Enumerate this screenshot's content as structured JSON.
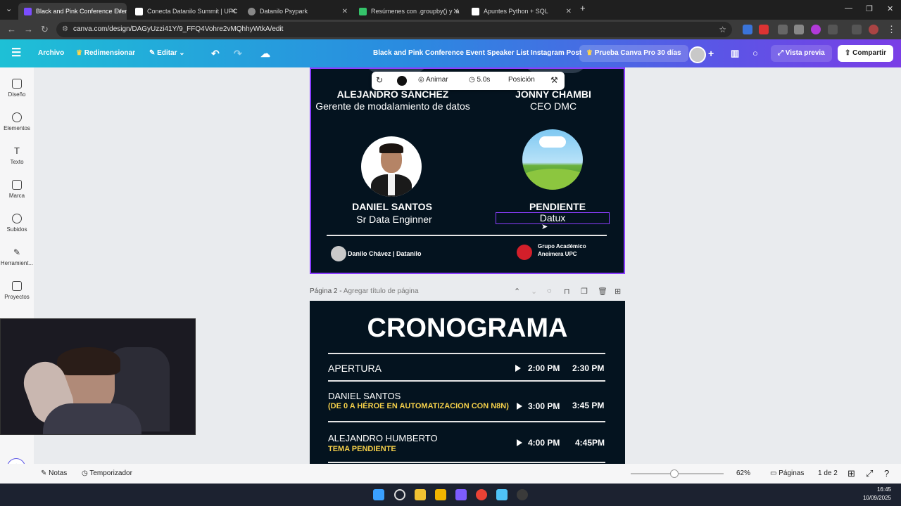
{
  "browser": {
    "tabs": [
      {
        "title": "Black and Pink Conference Even",
        "active": true
      },
      {
        "title": "Conecta Datanilo Summit | UPC",
        "active": false
      },
      {
        "title": "Datanilo Psypark",
        "active": false
      },
      {
        "title": "Resúmenes con .groupby() y .a",
        "active": false
      },
      {
        "title": "Apuntes Python + SQL",
        "active": false
      }
    ],
    "new_tab": "+",
    "url": "canva.com/design/DAGyUzzi41Y/9_FFQ4Vohre2vMQhhyWtkA/edit"
  },
  "header": {
    "menu_file": "Archivo",
    "resize": "Redimensionar",
    "edit": "Editar",
    "doc_title": "Black and Pink Conference Event Speaker List Instagram Post",
    "try_pro": "Prueba Canva Pro 30 días",
    "preview": "Vista previa",
    "share": "Compartir"
  },
  "sidebar": {
    "items": [
      {
        "label": "Diseño"
      },
      {
        "label": "Elementos"
      },
      {
        "label": "Texto"
      },
      {
        "label": "Marca"
      },
      {
        "label": "Subidos"
      },
      {
        "label": "Herramient..."
      },
      {
        "label": "Proyectos"
      }
    ]
  },
  "element_toolbar": {
    "animate": "Animar",
    "duration": "5.0s",
    "position": "Posición"
  },
  "page1": {
    "speakers": [
      {
        "name": "ALEJANDRO SÁNCHEZ",
        "role": "Gerente de modalamiento de datos"
      },
      {
        "name": "JONNY CHAMBI",
        "role": "CEO DMC"
      },
      {
        "name": "DANIEL SANTOS",
        "role": "Sr Data Enginner"
      },
      {
        "name": "PENDIENTE",
        "role": "Datux"
      }
    ],
    "footer_left": "Danilo Chávez | Datanilo",
    "footer_right_line1": "Grupo Académico",
    "footer_right_line2": "Aneimera UPC"
  },
  "page2": {
    "label_prefix": "Página 2 - ",
    "label_placeholder": "Agregar título de página",
    "title": "CRONOGRAMA",
    "rows": [
      {
        "title": "APERTURA",
        "subtitle": "",
        "start": "2:00 PM",
        "end": "2:30 PM"
      },
      {
        "title": "DANIEL SANTOS",
        "subtitle": "(DE 0 A HÉROE EN AUTOMATIZACION CON N8N)",
        "start": "3:00 PM",
        "end": "3:45 PM"
      },
      {
        "title": "ALEJANDRO HUMBERTO",
        "subtitle": "TEMA PENDIENTE",
        "start": "4:00 PM",
        "end": "4:45PM"
      }
    ]
  },
  "bottom": {
    "notes": "Notas",
    "timer": "Temporizador",
    "zoom": "62%",
    "pages": "Páginas",
    "page_count": "1 de 2"
  },
  "taskbar": {
    "time": "16:45",
    "date": "10/09/2025"
  },
  "colors": {
    "canvas_bg": "#04131f",
    "accent": "#8b3dff",
    "highlight_text": "#f5d04a"
  }
}
